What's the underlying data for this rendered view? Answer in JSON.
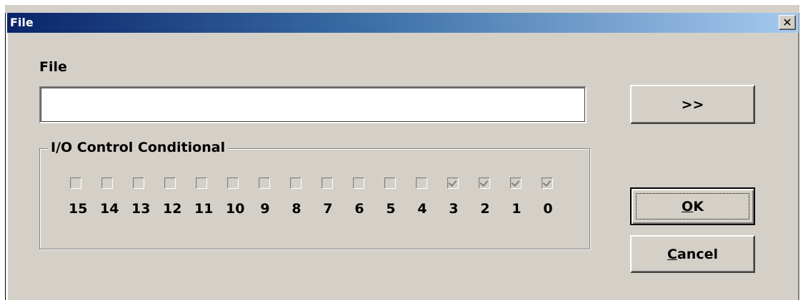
{
  "window": {
    "title": "File",
    "close_glyph": "✕"
  },
  "file": {
    "label": "File",
    "value": "",
    "browse_label": ">>"
  },
  "io_group": {
    "title": "I/O Control Conditional",
    "bits": [
      {
        "num": "15",
        "checked": false
      },
      {
        "num": "14",
        "checked": false
      },
      {
        "num": "13",
        "checked": false
      },
      {
        "num": "12",
        "checked": false
      },
      {
        "num": "11",
        "checked": false
      },
      {
        "num": "10",
        "checked": false
      },
      {
        "num": "9",
        "checked": false
      },
      {
        "num": "8",
        "checked": false
      },
      {
        "num": "7",
        "checked": false
      },
      {
        "num": "6",
        "checked": false
      },
      {
        "num": "5",
        "checked": false
      },
      {
        "num": "4",
        "checked": false
      },
      {
        "num": "3",
        "checked": true
      },
      {
        "num": "2",
        "checked": true
      },
      {
        "num": "1",
        "checked": true
      },
      {
        "num": "0",
        "checked": true
      }
    ]
  },
  "buttons": {
    "ok_mnemonic": "O",
    "ok_rest": "K",
    "cancel_mnemonic": "C",
    "cancel_rest": "ancel"
  },
  "colors": {
    "title_start": "#0a246a",
    "title_end": "#a6caf0",
    "face": "#d4d0c8"
  }
}
